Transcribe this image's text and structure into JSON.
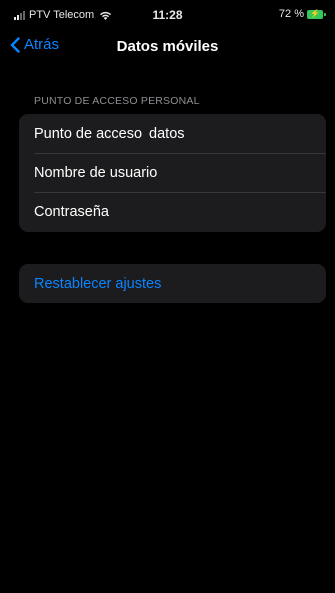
{
  "status_bar": {
    "carrier": "PTV Telecom",
    "time": "11:28",
    "battery": "72 %",
    "signal_icon": "signal-bars-icon",
    "wifi_icon": "wifi-icon",
    "battery_icon": "battery-charging-icon",
    "battery_color": "#35c759"
  },
  "nav": {
    "back_label": "Atrás",
    "title": "Datos móviles",
    "accent_color": "#0a84ff"
  },
  "hotspot_section": {
    "header": "PUNTO DE ACCESO PERSONAL",
    "rows": [
      {
        "label": "Punto de acceso",
        "value": "datos"
      },
      {
        "label": "Nombre de usuario",
        "value": ""
      },
      {
        "label": "Contraseña",
        "value": ""
      }
    ]
  },
  "reset": {
    "label": "Restablecer ajustes"
  }
}
